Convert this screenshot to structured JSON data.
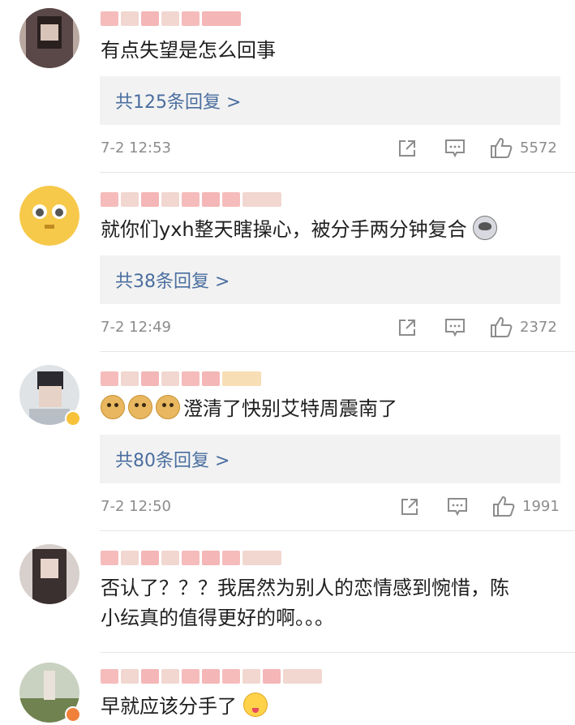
{
  "comments": [
    {
      "text": "有点失望是怎么回事",
      "emoji": [],
      "replies": "共125条回复 >",
      "time": "7-2 12:53",
      "likes": "5572",
      "avatar_color": "#4a3a3a"
    },
    {
      "text": "就你们yxh整天瞎操心，被分手两分钟复合",
      "emoji_after": "husky-emoji",
      "replies": "共38条回复 >",
      "time": "7-2 12:49",
      "likes": "2372",
      "avatar_color": "#f6c94a"
    },
    {
      "text": "澄清了快别艾特周震南了",
      "emoji_before": [
        "doge-emoji",
        "doge-emoji",
        "doge-emoji"
      ],
      "replies": "共80条回复 >",
      "time": "7-2 12:50",
      "likes": "1991",
      "avatar_color": "#9aa3ad"
    },
    {
      "text_line1": "否认了？？？我居然为别人的恋情感到惋惜，陈",
      "text_line2": "小纭真的值得更好的啊。。。",
      "avatar_color": "#3a3030"
    },
    {
      "text": "早就应该分手了",
      "emoji_after": "yum-emoji",
      "avatar_color": "#7c8a60"
    }
  ],
  "icons": {
    "share": "share-icon",
    "comment": "comment-icon",
    "like": "thumbs-up-icon"
  },
  "colors": {
    "link": "#4a6e9f",
    "meta": "#8c8c8c",
    "reply_bg": "#f2f2f2"
  }
}
